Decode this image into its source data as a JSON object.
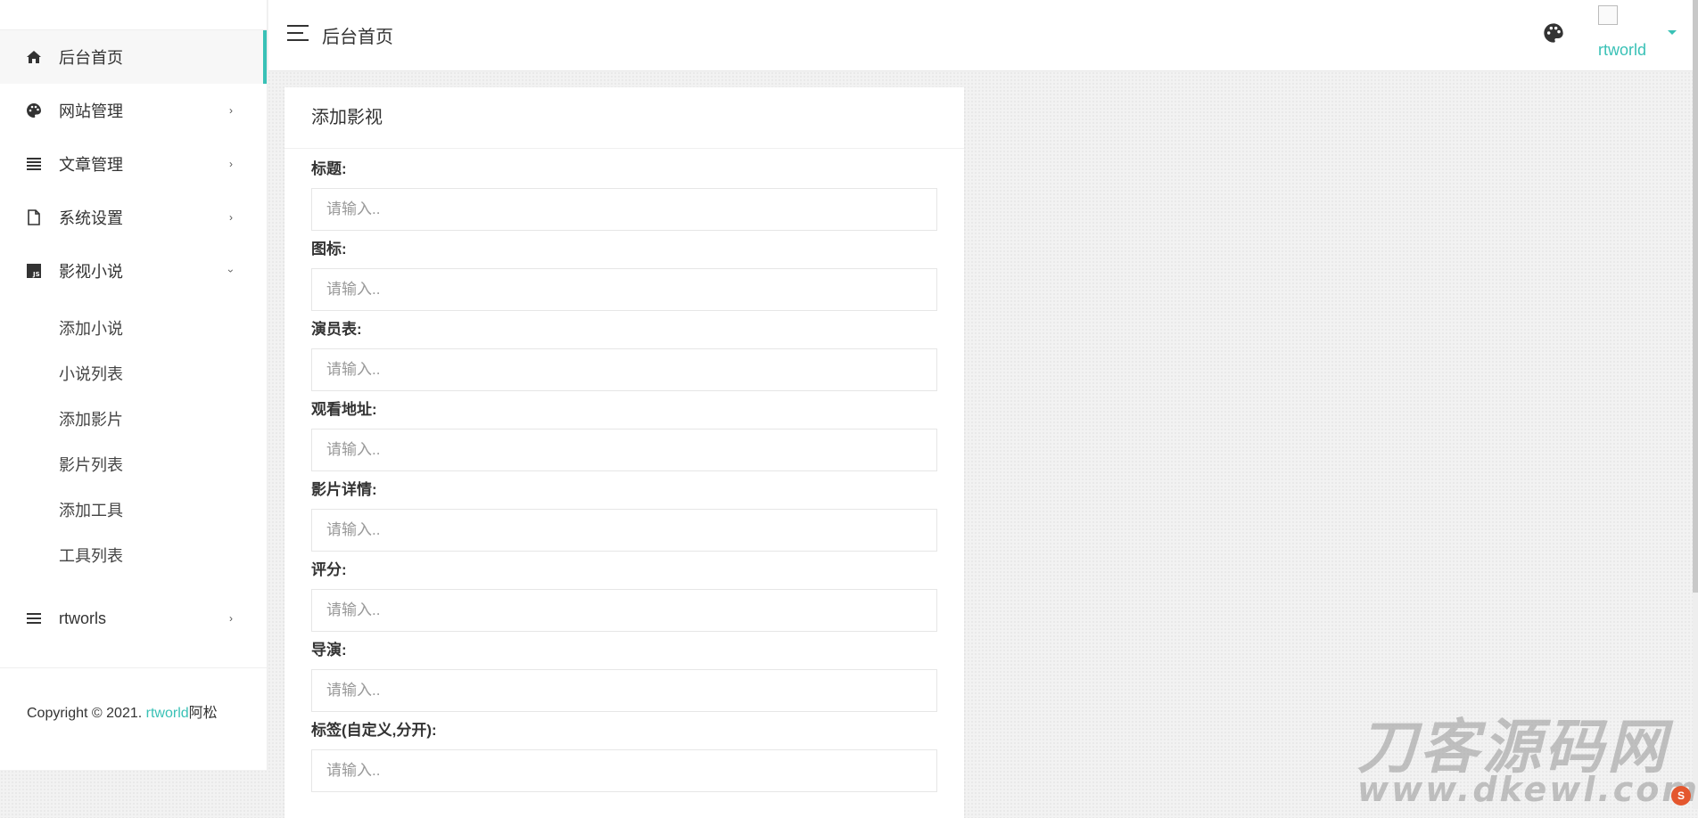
{
  "sidebar": {
    "items": [
      {
        "label": "后台首页",
        "icon": "home-icon"
      },
      {
        "label": "网站管理",
        "icon": "palette-icon"
      },
      {
        "label": "文章管理",
        "icon": "list-icon"
      },
      {
        "label": "系统设置",
        "icon": "file-icon"
      },
      {
        "label": "影视小说",
        "icon": "js-icon"
      }
    ],
    "subitems": [
      "添加小说",
      "小说列表",
      "添加影片",
      "影片列表",
      "添加工具",
      "工具列表"
    ],
    "extra_item": {
      "label": "rtworls",
      "icon": "menu-icon"
    },
    "copyright": {
      "prefix": "Copyright © 2021. ",
      "brand": "rtworld",
      "suffix": "阿松"
    }
  },
  "header": {
    "title": "后台首页",
    "username": "rtworld"
  },
  "card": {
    "title": "添加影视",
    "fields": [
      {
        "label": "标题:",
        "placeholder": "请输入.."
      },
      {
        "label": "图标:",
        "placeholder": "请输入.."
      },
      {
        "label": "演员表:",
        "placeholder": "请输入.."
      },
      {
        "label": "观看地址:",
        "placeholder": "请输入.."
      },
      {
        "label": "影片详情:",
        "placeholder": "请输入.."
      },
      {
        "label": "评分:",
        "placeholder": "请输入.."
      },
      {
        "label": "导演:",
        "placeholder": "请输入.."
      },
      {
        "label": "标签(自定义,分开):",
        "placeholder": "请输入.."
      }
    ]
  },
  "watermark": {
    "cn": "刀客源码网",
    "en": "www.dkewl.com"
  },
  "colors": {
    "accent": "#39c1b6"
  }
}
